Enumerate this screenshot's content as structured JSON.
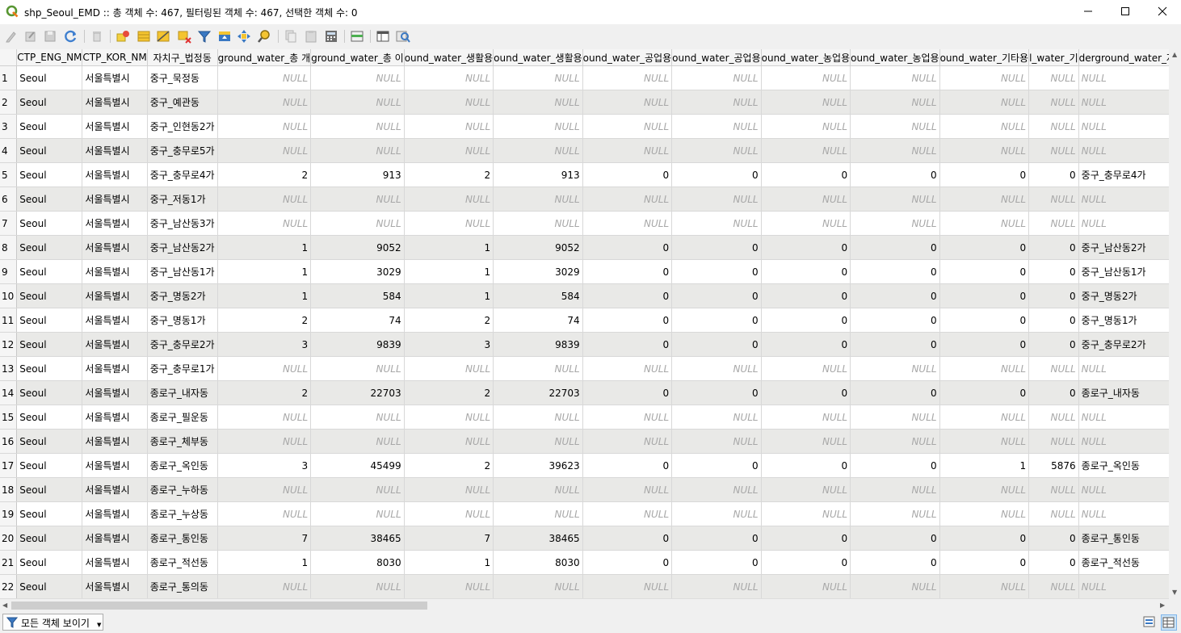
{
  "window": {
    "title": "shp_Seoul_EMD :: 총 객체 수: 467, 필터링된 객체 수: 467, 선택한 객체 수: 0"
  },
  "toolbar": {
    "icons": [
      "pencil-icon",
      "multi-edit-icon",
      "save-icon",
      "reload-icon",
      "delete-icon",
      "add-feature-icon",
      "select-all-icon",
      "invert-selection-icon",
      "deselect-icon",
      "filter-select-icon",
      "move-to-top-icon",
      "pan-to-selection-icon",
      "zoom-to-selection-icon",
      "copy-icon",
      "paste-icon",
      "field-calculator-icon",
      "conditional-format-icon",
      "dock-icon",
      "actions-icon"
    ]
  },
  "table": {
    "columns": [
      "CTP_ENG_NM",
      "CTP_KOR_NM",
      "자치구_법정동",
      "ground_water_총 개",
      "ground_water_총 이",
      "ound_water_생활용",
      "ound_water_생활용",
      "ound_water_공업용",
      "ound_water_공업용",
      "ound_water_농업용",
      "ound_water_농업용",
      "ound_water_기타용",
      "l_water_기",
      "derground_water_자치구_법정동"
    ],
    "rows": [
      {
        "n": "1",
        "eng": "Seoul",
        "kor": "서울특별시",
        "dong": "중구_묵정동",
        "v": [
          "NULL",
          "NULL",
          "NULL",
          "NULL",
          "NULL",
          "NULL",
          "NULL",
          "NULL",
          "NULL",
          "NULL"
        ],
        "last": "NULL"
      },
      {
        "n": "2",
        "eng": "Seoul",
        "kor": "서울특별시",
        "dong": "중구_예관동",
        "v": [
          "NULL",
          "NULL",
          "NULL",
          "NULL",
          "NULL",
          "NULL",
          "NULL",
          "NULL",
          "NULL",
          "NULL"
        ],
        "last": "NULL"
      },
      {
        "n": "3",
        "eng": "Seoul",
        "kor": "서울특별시",
        "dong": "중구_인현동2가",
        "v": [
          "NULL",
          "NULL",
          "NULL",
          "NULL",
          "NULL",
          "NULL",
          "NULL",
          "NULL",
          "NULL",
          "NULL"
        ],
        "last": "NULL"
      },
      {
        "n": "4",
        "eng": "Seoul",
        "kor": "서울특별시",
        "dong": "중구_충무로5가",
        "v": [
          "NULL",
          "NULL",
          "NULL",
          "NULL",
          "NULL",
          "NULL",
          "NULL",
          "NULL",
          "NULL",
          "NULL"
        ],
        "last": "NULL"
      },
      {
        "n": "5",
        "eng": "Seoul",
        "kor": "서울특별시",
        "dong": "중구_충무로4가",
        "v": [
          "2",
          "913",
          "2",
          "913",
          "0",
          "0",
          "0",
          "0",
          "0",
          "0"
        ],
        "last": "중구_충무로4가"
      },
      {
        "n": "6",
        "eng": "Seoul",
        "kor": "서울특별시",
        "dong": "중구_저동1가",
        "v": [
          "NULL",
          "NULL",
          "NULL",
          "NULL",
          "NULL",
          "NULL",
          "NULL",
          "NULL",
          "NULL",
          "NULL"
        ],
        "last": "NULL"
      },
      {
        "n": "7",
        "eng": "Seoul",
        "kor": "서울특별시",
        "dong": "중구_남산동3가",
        "v": [
          "NULL",
          "NULL",
          "NULL",
          "NULL",
          "NULL",
          "NULL",
          "NULL",
          "NULL",
          "NULL",
          "NULL"
        ],
        "last": "NULL"
      },
      {
        "n": "8",
        "eng": "Seoul",
        "kor": "서울특별시",
        "dong": "중구_남산동2가",
        "v": [
          "1",
          "9052",
          "1",
          "9052",
          "0",
          "0",
          "0",
          "0",
          "0",
          "0"
        ],
        "last": "중구_남산동2가"
      },
      {
        "n": "9",
        "eng": "Seoul",
        "kor": "서울특별시",
        "dong": "중구_남산동1가",
        "v": [
          "1",
          "3029",
          "1",
          "3029",
          "0",
          "0",
          "0",
          "0",
          "0",
          "0"
        ],
        "last": "중구_남산동1가"
      },
      {
        "n": "10",
        "eng": "Seoul",
        "kor": "서울특별시",
        "dong": "중구_명동2가",
        "v": [
          "1",
          "584",
          "1",
          "584",
          "0",
          "0",
          "0",
          "0",
          "0",
          "0"
        ],
        "last": "중구_명동2가"
      },
      {
        "n": "11",
        "eng": "Seoul",
        "kor": "서울특별시",
        "dong": "중구_명동1가",
        "v": [
          "2",
          "74",
          "2",
          "74",
          "0",
          "0",
          "0",
          "0",
          "0",
          "0"
        ],
        "last": "중구_명동1가"
      },
      {
        "n": "12",
        "eng": "Seoul",
        "kor": "서울특별시",
        "dong": "중구_충무로2가",
        "v": [
          "3",
          "9839",
          "3",
          "9839",
          "0",
          "0",
          "0",
          "0",
          "0",
          "0"
        ],
        "last": "중구_충무로2가"
      },
      {
        "n": "13",
        "eng": "Seoul",
        "kor": "서울특별시",
        "dong": "중구_충무로1가",
        "v": [
          "NULL",
          "NULL",
          "NULL",
          "NULL",
          "NULL",
          "NULL",
          "NULL",
          "NULL",
          "NULL",
          "NULL"
        ],
        "last": "NULL"
      },
      {
        "n": "14",
        "eng": "Seoul",
        "kor": "서울특별시",
        "dong": "종로구_내자동",
        "v": [
          "2",
          "22703",
          "2",
          "22703",
          "0",
          "0",
          "0",
          "0",
          "0",
          "0"
        ],
        "last": "종로구_내자동"
      },
      {
        "n": "15",
        "eng": "Seoul",
        "kor": "서울특별시",
        "dong": "종로구_필운동",
        "v": [
          "NULL",
          "NULL",
          "NULL",
          "NULL",
          "NULL",
          "NULL",
          "NULL",
          "NULL",
          "NULL",
          "NULL"
        ],
        "last": "NULL"
      },
      {
        "n": "16",
        "eng": "Seoul",
        "kor": "서울특별시",
        "dong": "종로구_체부동",
        "v": [
          "NULL",
          "NULL",
          "NULL",
          "NULL",
          "NULL",
          "NULL",
          "NULL",
          "NULL",
          "NULL",
          "NULL"
        ],
        "last": "NULL"
      },
      {
        "n": "17",
        "eng": "Seoul",
        "kor": "서울특별시",
        "dong": "종로구_옥인동",
        "v": [
          "3",
          "45499",
          "2",
          "39623",
          "0",
          "0",
          "0",
          "0",
          "1",
          "5876"
        ],
        "last": "종로구_옥인동"
      },
      {
        "n": "18",
        "eng": "Seoul",
        "kor": "서울특별시",
        "dong": "종로구_누하동",
        "v": [
          "NULL",
          "NULL",
          "NULL",
          "NULL",
          "NULL",
          "NULL",
          "NULL",
          "NULL",
          "NULL",
          "NULL"
        ],
        "last": "NULL"
      },
      {
        "n": "19",
        "eng": "Seoul",
        "kor": "서울특별시",
        "dong": "종로구_누상동",
        "v": [
          "NULL",
          "NULL",
          "NULL",
          "NULL",
          "NULL",
          "NULL",
          "NULL",
          "NULL",
          "NULL",
          "NULL"
        ],
        "last": "NULL"
      },
      {
        "n": "20",
        "eng": "Seoul",
        "kor": "서울특별시",
        "dong": "종로구_통인동",
        "v": [
          "7",
          "38465",
          "7",
          "38465",
          "0",
          "0",
          "0",
          "0",
          "0",
          "0"
        ],
        "last": "종로구_통인동"
      },
      {
        "n": "21",
        "eng": "Seoul",
        "kor": "서울특별시",
        "dong": "종로구_적선동",
        "v": [
          "1",
          "8030",
          "1",
          "8030",
          "0",
          "0",
          "0",
          "0",
          "0",
          "0"
        ],
        "last": "종로구_적선동"
      },
      {
        "n": "22",
        "eng": "Seoul",
        "kor": "서울특별시",
        "dong": "종로구_통의동",
        "v": [
          "NULL",
          "NULL",
          "NULL",
          "NULL",
          "NULL",
          "NULL",
          "NULL",
          "NULL",
          "NULL",
          "NULL"
        ],
        "last": "NULL"
      }
    ]
  },
  "status": {
    "filter_label": "모든 객체 보이기"
  },
  "colors": {
    "alt_row": "#e9e9e7",
    "null_text": "#a8a8a8",
    "qgis_green": "#589632"
  }
}
